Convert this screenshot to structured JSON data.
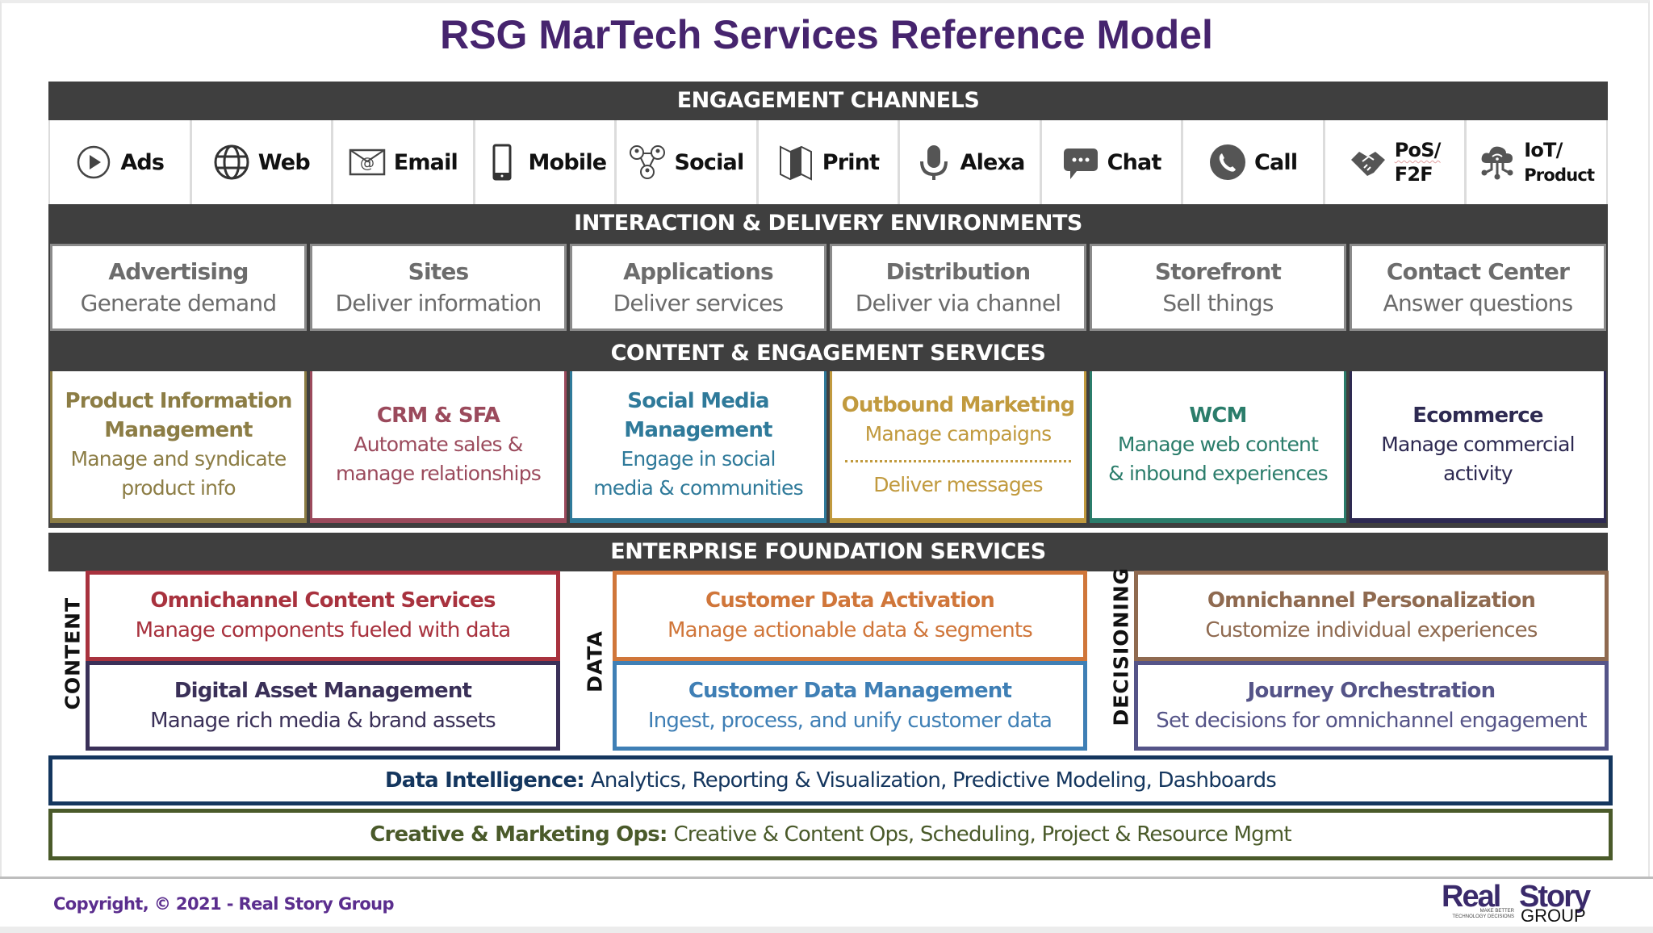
{
  "title": "RSG MarTech Services Reference Model",
  "sections": {
    "engagement_channels": "ENGAGEMENT CHANNELS",
    "interaction_delivery": "INTERACTION & DELIVERY ENVIRONMENTS",
    "content_engagement": "CONTENT & ENGAGEMENT SERVICES",
    "enterprise_foundation": "ENTERPRISE FOUNDATION SERVICES"
  },
  "channels": [
    {
      "label": "Ads",
      "icon": "play-circle-icon"
    },
    {
      "label": "Web",
      "icon": "globe-icon"
    },
    {
      "label": "Email",
      "icon": "envelope-at-icon"
    },
    {
      "label": "Mobile",
      "icon": "mobile-phone-icon"
    },
    {
      "label": "Social",
      "icon": "social-network-icon"
    },
    {
      "label": "Print",
      "icon": "folded-map-icon"
    },
    {
      "label": "Alexa",
      "icon": "microphone-icon"
    },
    {
      "label": "Chat",
      "icon": "chat-bubble-icon"
    },
    {
      "label": "Call",
      "icon": "phone-icon"
    },
    {
      "label_line1": "PoS/",
      "label_line2": "F2F",
      "icon": "handshake-icon"
    },
    {
      "label_line1": "IoT/",
      "label_line2": "Product",
      "icon": "cloud-iot-icon"
    }
  ],
  "environments": [
    {
      "title": "Advertising",
      "subtitle": "Generate demand"
    },
    {
      "title": "Sites",
      "subtitle": "Deliver information"
    },
    {
      "title": "Applications",
      "subtitle": "Deliver services"
    },
    {
      "title": "Distribution",
      "subtitle": "Deliver via channel"
    },
    {
      "title": "Storefront",
      "subtitle": "Sell things"
    },
    {
      "title": "Contact Center",
      "subtitle": "Answer questions"
    }
  ],
  "services": [
    {
      "title_line1": "Product Information",
      "title_line2": "Management",
      "desc_line1": "Manage and syndicate",
      "desc_line2": "product info",
      "color": "#8c7d45"
    },
    {
      "title_line1": "CRM & SFA",
      "desc_line1": "Automate sales &",
      "desc_line2": "manage relationships",
      "color": "#9b4a5c"
    },
    {
      "title_line1": "Social Media",
      "title_line2": "Management",
      "desc_line1": "Engage in social",
      "desc_line2": "media & communities",
      "color": "#2f7a9a"
    },
    {
      "title_line1": "Outbound Marketing",
      "desc_line1": "Manage campaigns",
      "desc_line2": "Deliver messages",
      "color": "#c19a3e"
    },
    {
      "title_line1": "WCM",
      "desc_line1": "Manage web content",
      "desc_line2": "& inbound experiences",
      "color": "#2b7d6b"
    },
    {
      "title_line1": "Ecommerce",
      "desc_line1": "Manage commercial",
      "desc_line2": "activity",
      "color": "#2e2a52"
    }
  ],
  "foundation": {
    "groups": {
      "content": "CONTENT",
      "data": "DATA",
      "decisioning": "DECISIONING"
    },
    "boxes": {
      "omnichannel_content": {
        "title": "Omnichannel Content Services",
        "desc": "Manage components fueled with data",
        "color": "#a8323e"
      },
      "dam": {
        "title": "Digital Asset Management",
        "desc": "Manage rich media & brand assets",
        "color": "#3a3058"
      },
      "cda": {
        "title": "Customer Data Activation",
        "desc": "Manage actionable data & segments",
        "color": "#d0763a"
      },
      "cdm": {
        "title": "Customer Data Management",
        "desc": "Ingest, process, and unify customer data",
        "color": "#3f7fb5"
      },
      "personalization": {
        "title": "Omnichannel Personalization",
        "desc": "Customize individual experiences",
        "color": "#8f6a50"
      },
      "journey": {
        "title": "Journey Orchestration",
        "desc": "Set decisions for omnichannel engagement",
        "color": "#555488"
      }
    }
  },
  "bars": {
    "data_intelligence": {
      "label": "Data Intelligence:",
      "text": "Analytics, Reporting & Visualization, Predictive Modeling, Dashboards",
      "color": "#14365e"
    },
    "creative_ops": {
      "label": "Creative & Marketing Ops:",
      "text": "Creative & Content Ops, Scheduling, Project & Resource Mgmt",
      "color": "#4a5a2a"
    }
  },
  "footer": {
    "copyright": "Copyright, © 2021 - Real Story Group",
    "logo_real": "Real",
    "logo_story": "Story",
    "logo_group": "GROUP",
    "logo_tagline_1": "MAKE BETTER",
    "logo_tagline_2": "TECHNOLOGY DECISIONS"
  }
}
